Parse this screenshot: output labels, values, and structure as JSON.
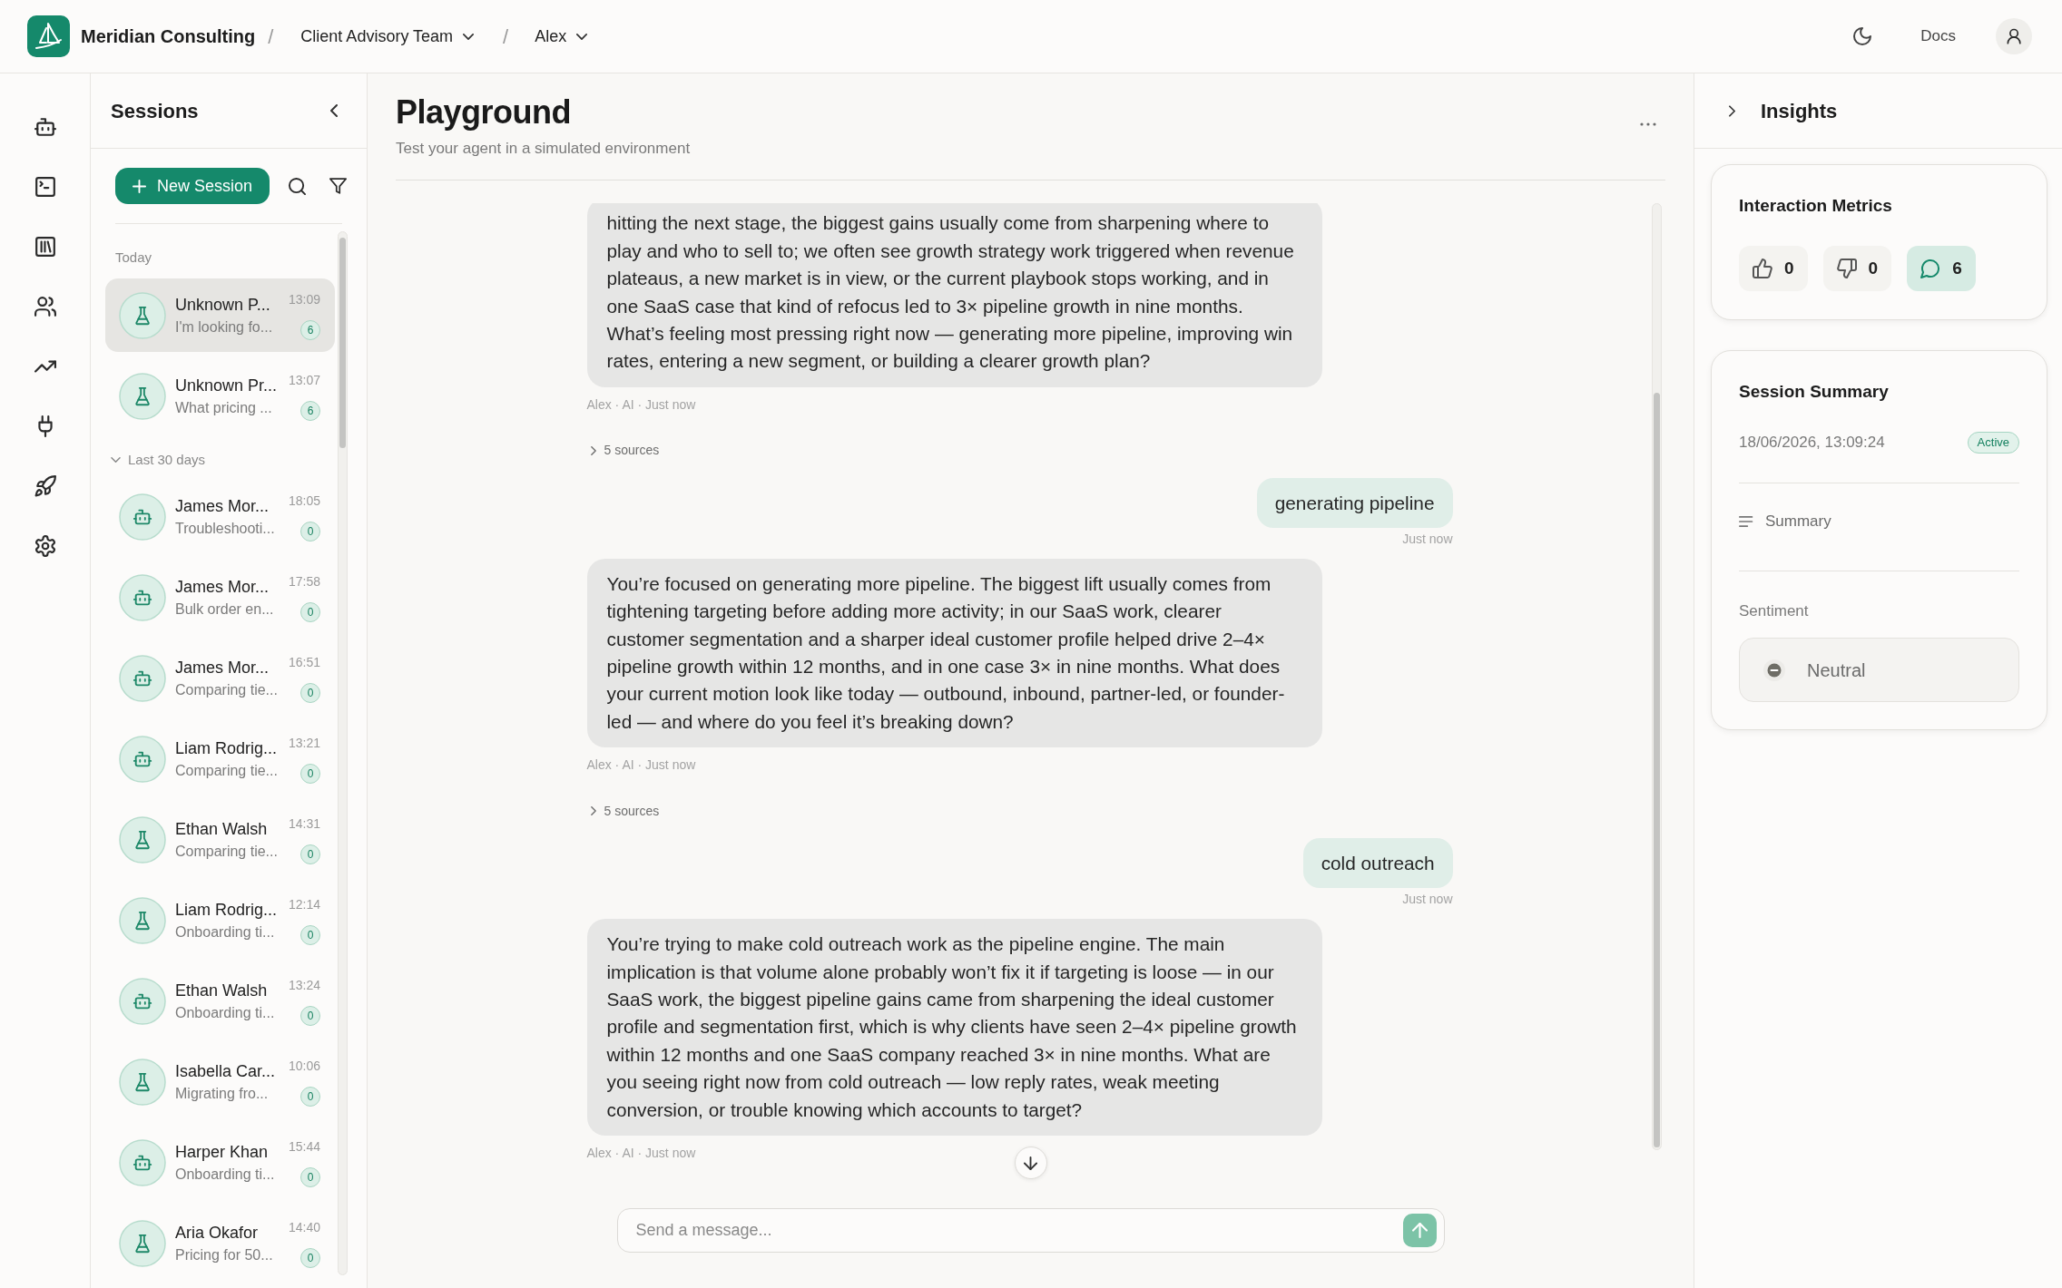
{
  "topbar": {
    "brand": "Meridian Consulting",
    "breadcrumbs": [
      {
        "separator": "/",
        "label": "Client Advisory Team"
      },
      {
        "separator": "/",
        "label": "Alex"
      }
    ],
    "docs_link": "Docs"
  },
  "sessions": {
    "title": "Sessions",
    "new_button": "New Session",
    "today": {
      "label": "Today",
      "items": [
        {
          "kind": "flask",
          "title": "Unknown P...",
          "preview": "I'm looking fo...",
          "time": "13:09",
          "count": "6",
          "selected": true
        },
        {
          "kind": "flask",
          "title": "Unknown Pr...",
          "preview": "What pricing ...",
          "time": "13:07",
          "count": "6",
          "selected": false
        }
      ]
    },
    "earlier": {
      "label": "Last 30 days",
      "expanded": true,
      "items": [
        {
          "kind": "robot",
          "title": "James Mor...",
          "preview": "Troubleshooti...",
          "time": "18:05",
          "count": "0",
          "selected": false
        },
        {
          "kind": "robot",
          "title": "James Mor...",
          "preview": "Bulk order en...",
          "time": "17:58",
          "count": "0",
          "selected": false
        },
        {
          "kind": "robot",
          "title": "James Mor...",
          "preview": "Comparing tie...",
          "time": "16:51",
          "count": "0",
          "selected": false
        },
        {
          "kind": "robot",
          "title": "Liam Rodrig...",
          "preview": "Comparing tie...",
          "time": "13:21",
          "count": "0",
          "selected": false
        },
        {
          "kind": "flask",
          "title": "Ethan Walsh",
          "preview": "Comparing tie...",
          "time": "14:31",
          "count": "0",
          "selected": false
        },
        {
          "kind": "flask",
          "title": "Liam Rodrig...",
          "preview": "Onboarding ti...",
          "time": "12:14",
          "count": "0",
          "selected": false
        },
        {
          "kind": "robot",
          "title": "Ethan Walsh",
          "preview": "Onboarding ti...",
          "time": "13:24",
          "count": "0",
          "selected": false
        },
        {
          "kind": "flask",
          "title": "Isabella Car...",
          "preview": "Migrating fro...",
          "time": "10:06",
          "count": "0",
          "selected": false
        },
        {
          "kind": "robot",
          "title": "Harper Khan",
          "preview": "Onboarding ti...",
          "time": "15:44",
          "count": "0",
          "selected": false
        },
        {
          "kind": "flask",
          "title": "Aria Okafor",
          "preview": "Pricing for 50...",
          "time": "14:40",
          "count": "0",
          "selected": false
        }
      ]
    }
  },
  "playground": {
    "title": "Playground",
    "subtitle": "Test your agent in a simulated environment",
    "messages": [
      {
        "kind": "agent",
        "text": "hitting the next stage, the biggest gains usually come from sharpening where to play and who to sell to; we often see growth strategy work triggered when revenue plateaus, a new market is in view, or the current playbook stops working, and in one SaaS case that kind of refocus led to 3× pipeline growth in nine months. What’s feeling most pressing right now — generating more pipeline, improving win rates, entering a new segment, or building a clearer growth plan?",
        "meta": "Alex · AI · Just now",
        "sources": {
          "label": "5 sources",
          "expanded": false
        }
      },
      {
        "kind": "user",
        "text": "generating pipeline",
        "time": "Just now"
      },
      {
        "kind": "agent",
        "text": "You’re focused on generating more pipeline. The biggest lift usually comes from tightening targeting before adding more activity; in our SaaS work, clearer customer segmentation and a sharper ideal customer profile helped drive 2–4× pipeline growth within 12 months, and in one case 3× in nine months. What does your current motion look like today — outbound, inbound, partner-led, or founder-led — and where do you feel it’s breaking down?",
        "meta": "Alex · AI · Just now",
        "sources": {
          "label": "5 sources",
          "expanded": false
        }
      },
      {
        "kind": "user",
        "text": "cold outreach",
        "time": "Just now"
      },
      {
        "kind": "agent",
        "text": "You’re trying to make cold outreach work as the pipeline engine. The main implication is that volume alone probably won’t fix it if targeting is loose — in our SaaS work, the biggest pipeline gains came from sharpening the ideal customer profile and segmentation first, which is why clients have seen 2–4× pipeline growth within 12 months and one SaaS company reached 3× in nine months. What are you seeing right now from cold outreach — low reply rates, weak meeting conversion, or trouble knowing which accounts to target?",
        "meta": "Alex · AI · Just now"
      }
    ],
    "composer": {
      "placeholder": "Send a message..."
    }
  },
  "insights": {
    "title": "Insights",
    "metrics_card": {
      "title": "Interaction Metrics",
      "metrics": [
        {
          "kind": "thumbs_up",
          "value": "0",
          "selected": false
        },
        {
          "kind": "thumbs_down",
          "value": "0",
          "selected": false
        },
        {
          "kind": "messages",
          "value": "6",
          "selected": true
        }
      ]
    },
    "summary_card": {
      "title": "Session Summary",
      "timestamp": "18/06/2026, 13:09:24",
      "status": "Active",
      "summary_label": "Summary",
      "sentiment_label": "Sentiment",
      "sentiment": "Neutral"
    }
  }
}
